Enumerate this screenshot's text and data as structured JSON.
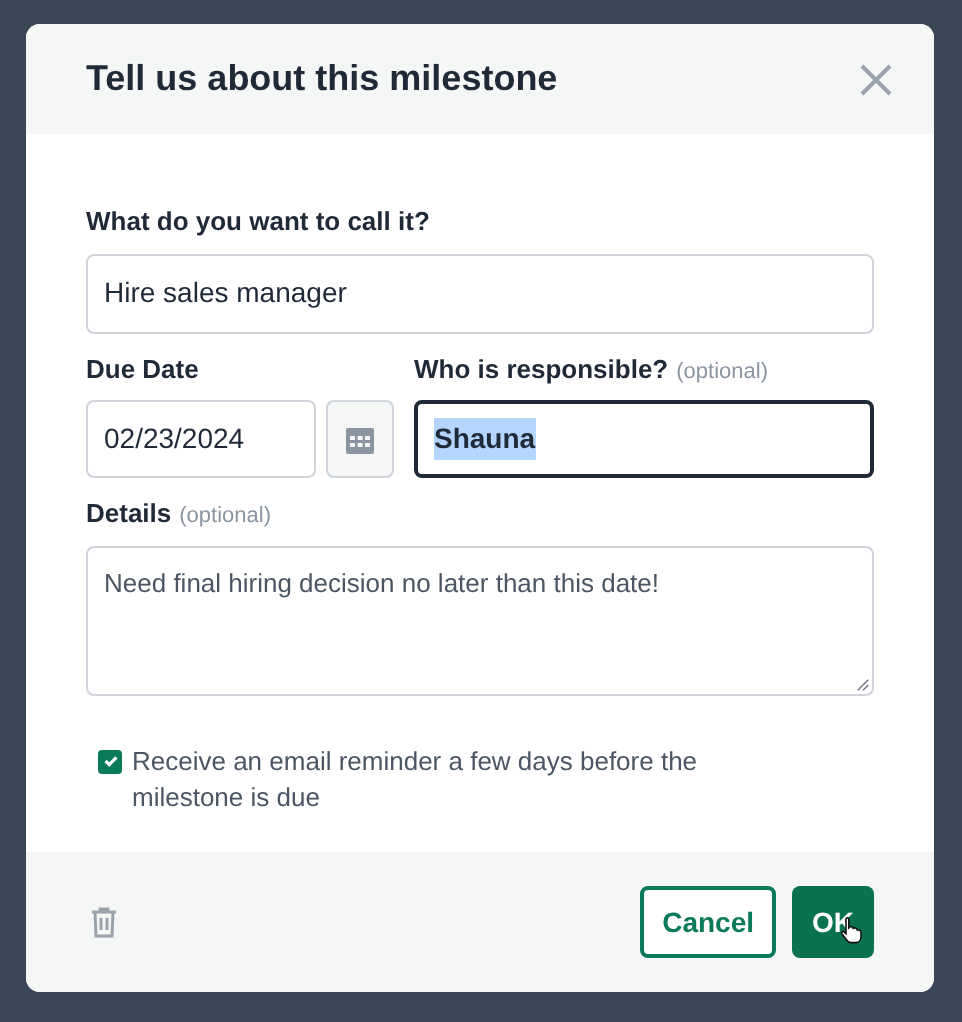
{
  "dialog": {
    "title": "Tell us about this milestone"
  },
  "name_field": {
    "label": "What do you want to call it?",
    "value": "Hire sales manager"
  },
  "due_date": {
    "label": "Due Date",
    "value": "02/23/2024"
  },
  "responsible": {
    "label": "Who is responsible?",
    "hint": "(optional)",
    "value": "Shauna",
    "focused": true,
    "text_selected": true
  },
  "details": {
    "label": "Details",
    "hint": "(optional)",
    "value": "Need final hiring decision no later than this date!"
  },
  "reminder": {
    "label": "Receive an email reminder a few days before the milestone is due",
    "checked": true
  },
  "buttons": {
    "cancel": "Cancel",
    "ok": "OK"
  }
}
